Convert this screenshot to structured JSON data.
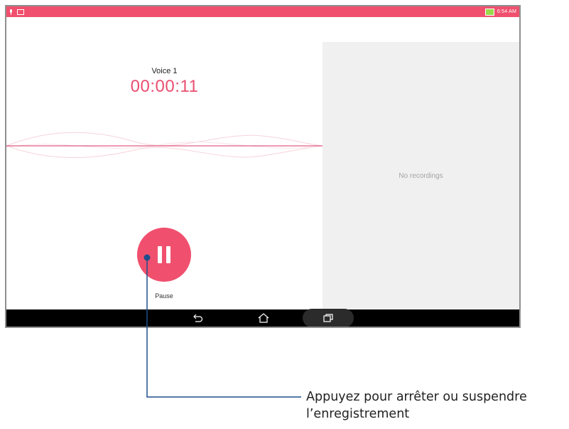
{
  "status_bar": {
    "time": "6:54 AM",
    "icons": [
      "mic-icon",
      "notification-icon",
      "battery-charging-icon"
    ],
    "color": "#f0506e"
  },
  "recorder": {
    "voice_name": "Voice 1",
    "elapsed": "00:00:11",
    "pause_label": "Pause",
    "accent_color": "#f0506e"
  },
  "recordings_panel": {
    "empty_text": "No recordings"
  },
  "nav_bar": {
    "buttons": [
      "back-icon",
      "home-icon",
      "recent-apps-icon"
    ]
  },
  "callout": {
    "line1": "Appuyez pour arrêter ou suspendre",
    "line2": "l’enregistrement",
    "line_color": "#1f4e8c"
  }
}
